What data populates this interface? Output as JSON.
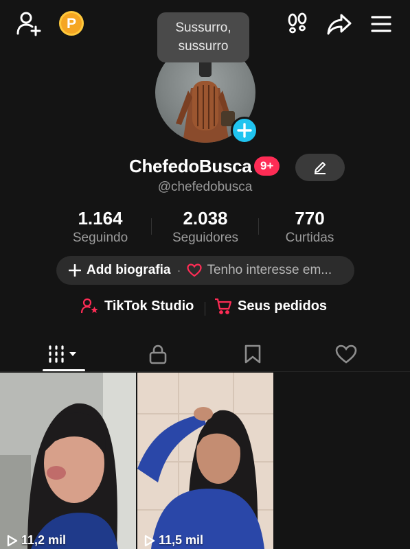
{
  "header": {
    "tooltip_line1": "Sussurro,",
    "tooltip_line2": "sussurro",
    "coin_letter": "P",
    "icons": [
      "add-friend-icon",
      "coin-icon",
      "footprints-icon",
      "share-icon",
      "menu-icon"
    ]
  },
  "profile": {
    "username": "ChefedoBusca",
    "notification_badge": "9+",
    "handle": "@chefedobusca"
  },
  "stats": [
    {
      "value": "1.164",
      "label": "Seguindo"
    },
    {
      "value": "2.038",
      "label": "Seguidores"
    },
    {
      "value": "770",
      "label": "Curtidas"
    }
  ],
  "bio": {
    "add_label": "Add biografia",
    "separator": "·",
    "interest_label": "Tenho interesse em..."
  },
  "links": {
    "studio_label": "TikTok Studio",
    "orders_label": "Seus pedidos"
  },
  "tabs": [
    "videos-grid",
    "private",
    "saved",
    "liked"
  ],
  "videos": [
    {
      "views": "11,2 mil"
    },
    {
      "views": "11,5 mil"
    }
  ],
  "colors": {
    "background": "#141414",
    "accent_red": "#fe2c55",
    "accent_cyan": "#20c4f0",
    "coin": "#f5a623"
  }
}
